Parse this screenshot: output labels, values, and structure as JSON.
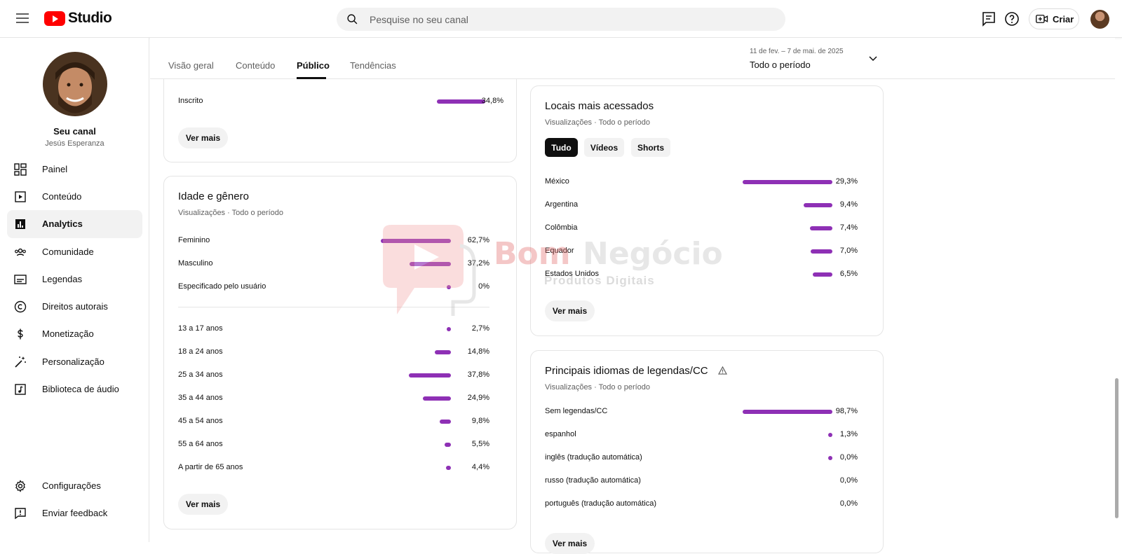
{
  "header": {
    "logo_text": "Studio",
    "search_placeholder": "Pesquise no seu canal",
    "create_label": "Criar"
  },
  "sidebar": {
    "channel_name": "Seu canal",
    "channel_handle": "Jesús Esperanza",
    "items": [
      {
        "label": "Painel",
        "icon": "dashboard-icon"
      },
      {
        "label": "Conteúdo",
        "icon": "content-icon"
      },
      {
        "label": "Analytics",
        "icon": "analytics-icon",
        "active": true
      },
      {
        "label": "Comunidade",
        "icon": "community-icon"
      },
      {
        "label": "Legendas",
        "icon": "subtitles-icon"
      },
      {
        "label": "Direitos autorais",
        "icon": "copyright-icon"
      },
      {
        "label": "Monetização",
        "icon": "monetization-icon"
      },
      {
        "label": "Personalização",
        "icon": "customization-icon"
      },
      {
        "label": "Biblioteca de áudio",
        "icon": "audio-library-icon"
      }
    ],
    "bottom_items": [
      {
        "label": "Configurações",
        "icon": "settings-icon"
      },
      {
        "label": "Enviar feedback",
        "icon": "feedback-icon"
      }
    ]
  },
  "tabs": [
    "Visão geral",
    "Conteúdo",
    "Público",
    "Tendências"
  ],
  "active_tab": "Público",
  "date_range": {
    "dates": "11 de fev. – 7 de mai. de 2025",
    "label": "Todo o período"
  },
  "subscription_card": {
    "row": {
      "label": "Inscrito",
      "value": "34,8%"
    },
    "more_label": "Ver mais"
  },
  "age_gender_card": {
    "title": "Idade e gênero",
    "subtitle": "Visualizações · Todo o período",
    "gender": [
      {
        "label": "Feminino",
        "value": "62,7%",
        "pct": 62.7
      },
      {
        "label": "Masculino",
        "value": "37,2%",
        "pct": 37.2
      },
      {
        "label": "Especificado pelo usuário",
        "value": "0%",
        "pct": 0
      }
    ],
    "age": [
      {
        "label": "13 a 17 anos",
        "value": "2,7%",
        "pct": 2.7
      },
      {
        "label": "18 a 24 anos",
        "value": "14,8%",
        "pct": 14.8
      },
      {
        "label": "25 a 34 anos",
        "value": "37,8%",
        "pct": 37.8
      },
      {
        "label": "35 a 44 anos",
        "value": "24,9%",
        "pct": 24.9
      },
      {
        "label": "45 a 54 anos",
        "value": "9,8%",
        "pct": 9.8
      },
      {
        "label": "55 a 64 anos",
        "value": "5,5%",
        "pct": 5.5
      },
      {
        "label": "A partir de 65 anos",
        "value": "4,4%",
        "pct": 4.4
      }
    ],
    "more_label": "Ver mais"
  },
  "locations_card": {
    "title": "Locais mais acessados",
    "subtitle": "Visualizações · Todo o período",
    "chips": [
      "Tudo",
      "Vídeos",
      "Shorts"
    ],
    "active_chip": "Tudo",
    "rows": [
      {
        "label": "México",
        "value": "29,3%",
        "pct": 29.3
      },
      {
        "label": "Argentina",
        "value": "9,4%",
        "pct": 9.4
      },
      {
        "label": "Colômbia",
        "value": "7,4%",
        "pct": 7.4
      },
      {
        "label": "Equador",
        "value": "7,0%",
        "pct": 7.0
      },
      {
        "label": "Estados Unidos",
        "value": "6,5%",
        "pct": 6.5
      }
    ],
    "more_label": "Ver mais"
  },
  "languages_card": {
    "title": "Principais idiomas de legendas/CC",
    "subtitle": "Visualizações · Todo o período",
    "rows": [
      {
        "label": "Sem legendas/CC",
        "value": "98,7%",
        "pct": 98.7
      },
      {
        "label": "espanhol",
        "value": "1,3%",
        "pct": 1.3
      },
      {
        "label": "inglês (tradução automática)",
        "value": "0,0%",
        "pct": 0.04
      },
      {
        "label": "russo (tradução automática)",
        "value": "0,0%",
        "pct": 0
      },
      {
        "label": "português (tradução automática)",
        "value": "0,0%",
        "pct": 0
      }
    ],
    "more_label": "Ver mais"
  },
  "watermark": {
    "brand_part1": "Bom",
    "brand_part2": "Negócio",
    "tagline": "Produtos Digitais"
  },
  "colors": {
    "bar": "#8e30b5",
    "brand_red": "#ff0000"
  }
}
